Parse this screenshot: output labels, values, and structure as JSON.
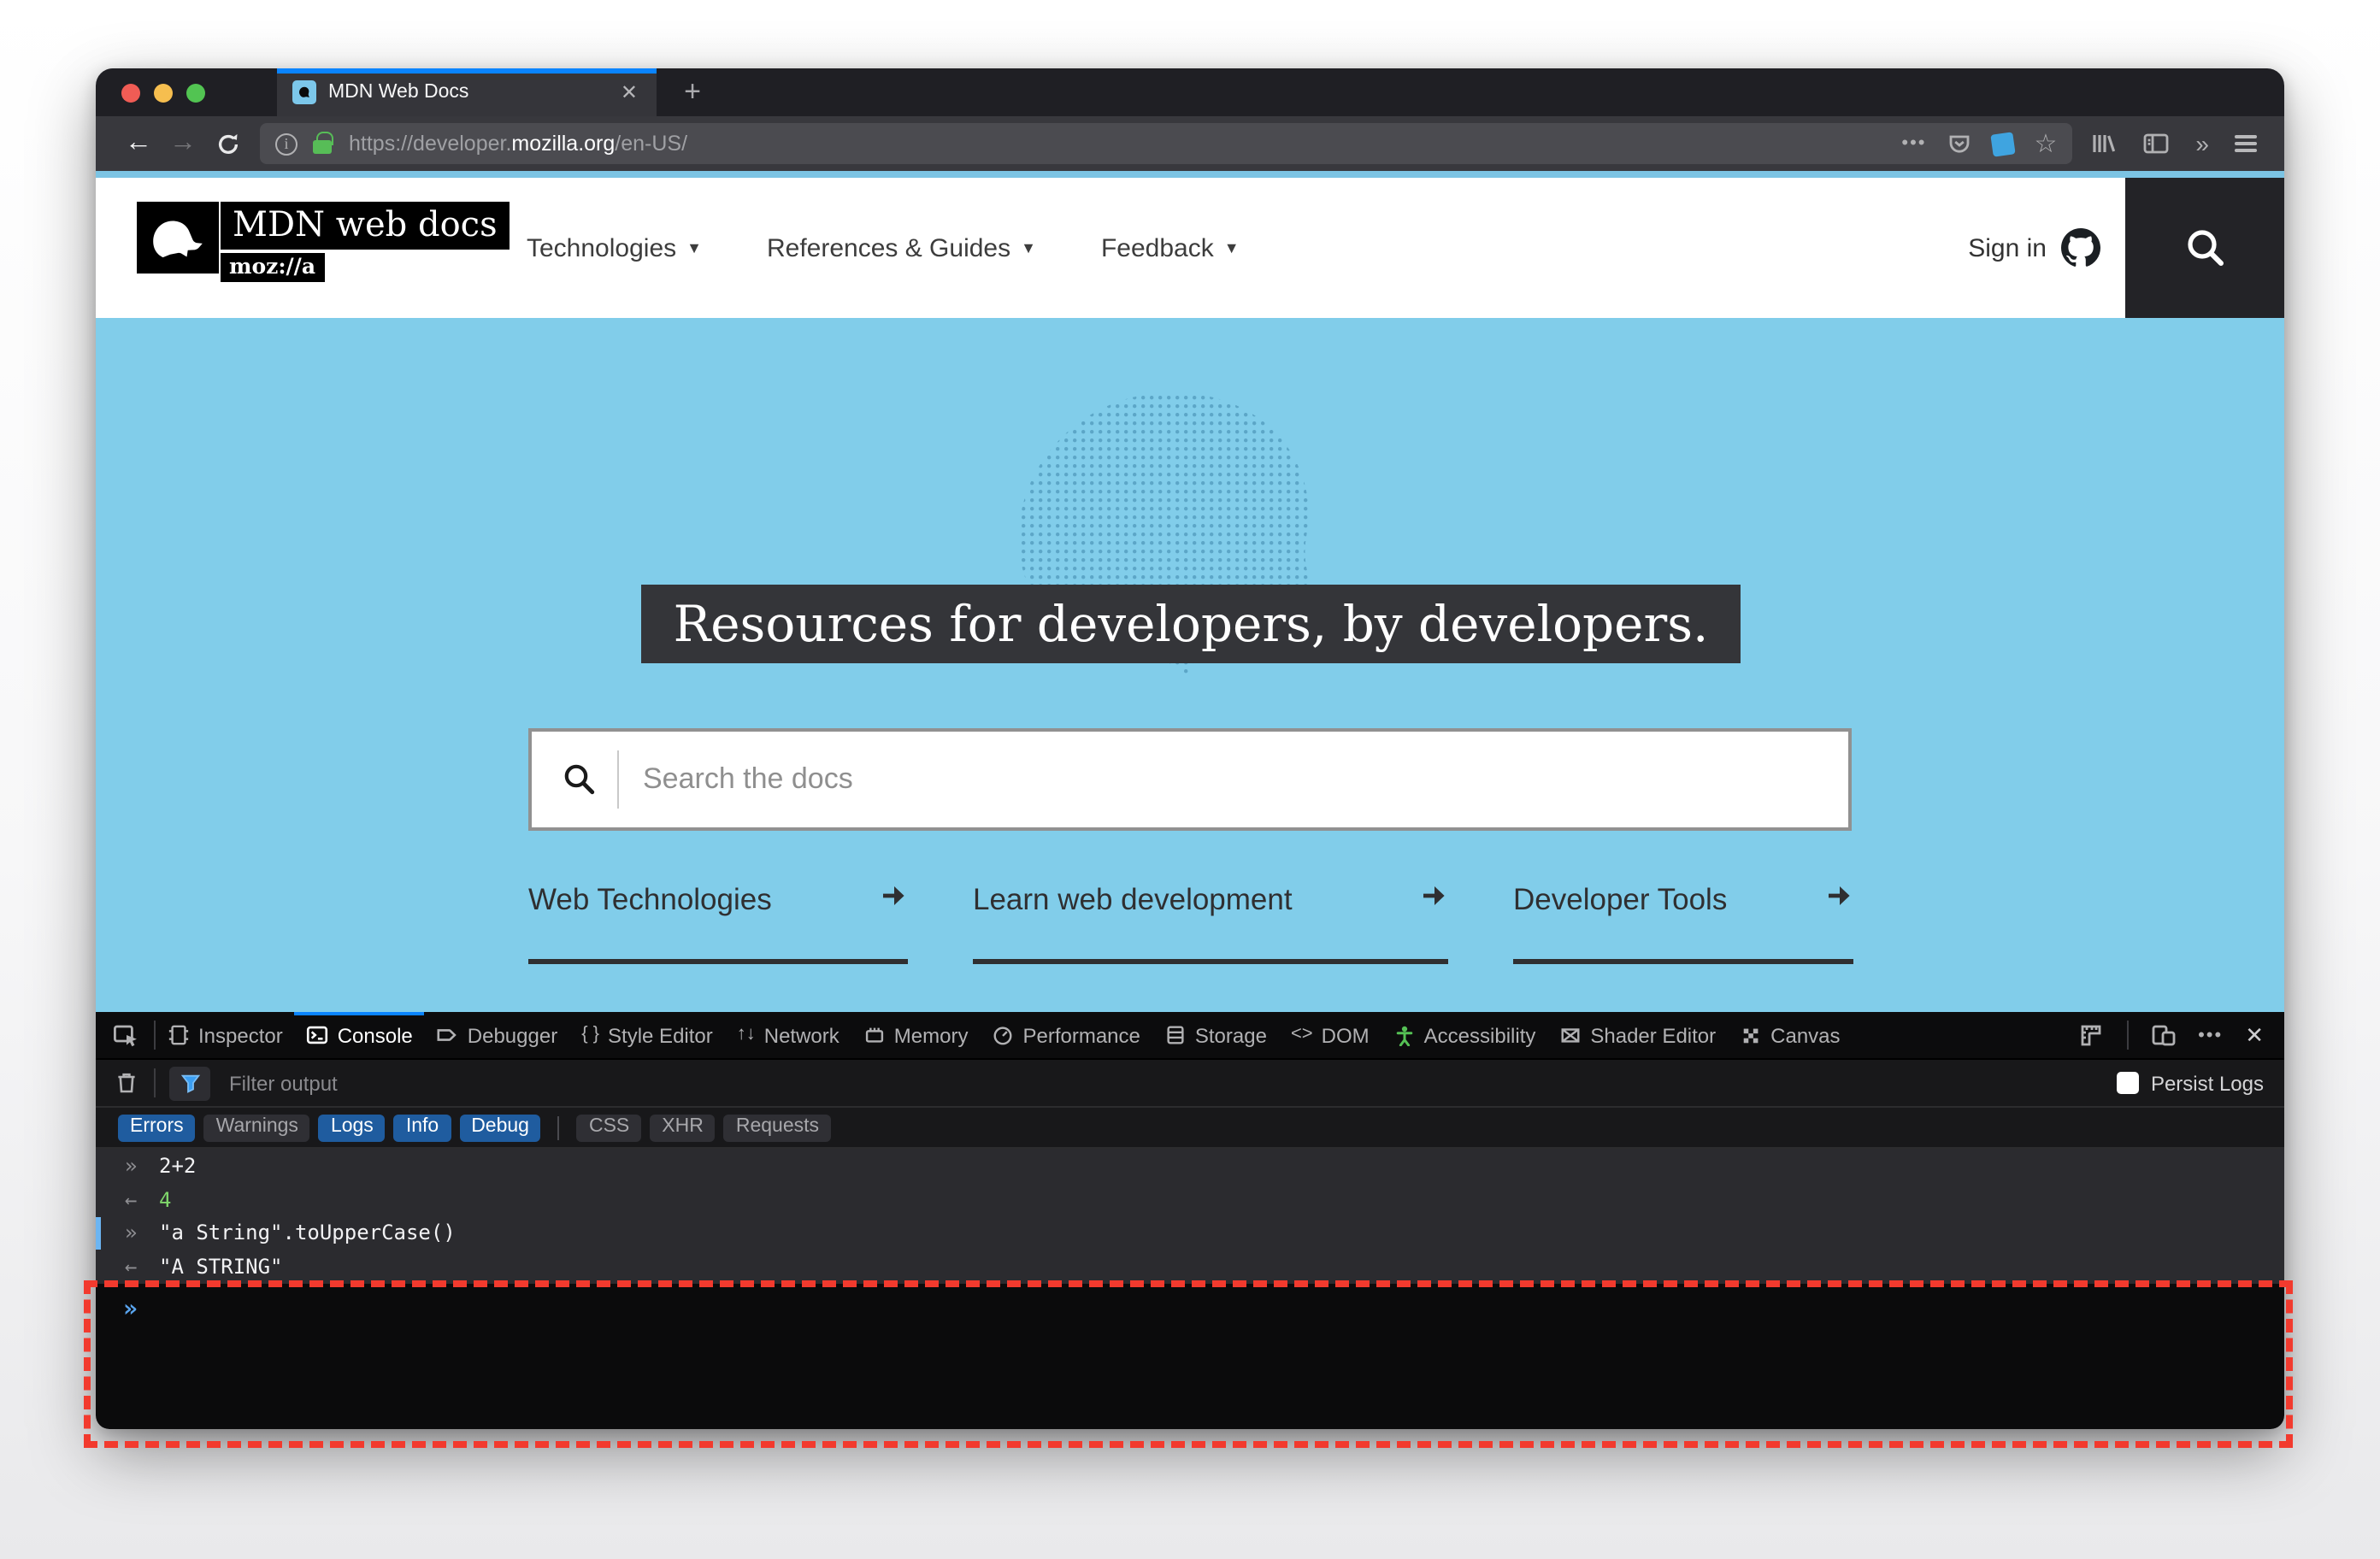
{
  "icons": {
    "close": "✕",
    "plus": "+",
    "back": "←",
    "forward": "→",
    "dots": "•••",
    "star": "☆",
    "double_chevron": "»",
    "caret": "▼",
    "braces": "{ }",
    "updown": "↑↓",
    "angle_brackets": "<>",
    "bullets": "•••"
  },
  "tab_bar": {
    "title": "MDN Web Docs"
  },
  "url_bar": {
    "prefix": "https://developer.",
    "domain": "mozilla.org",
    "path": "/en-US/"
  },
  "mdn_header": {
    "logo_title": "MDN web docs",
    "logo_tag": "moz://a",
    "nav": [
      {
        "label": "Technologies"
      },
      {
        "label": "References & Guides"
      },
      {
        "label": "Feedback"
      }
    ],
    "sign_in": "Sign in"
  },
  "hero": {
    "headline": "Resources for developers, by developers.",
    "search_placeholder": "Search the docs",
    "links": [
      {
        "label": "Web Technologies"
      },
      {
        "label": "Learn web development"
      },
      {
        "label": "Developer Tools"
      }
    ]
  },
  "devtools": {
    "tabs": [
      {
        "label": "Inspector",
        "active": false
      },
      {
        "label": "Console",
        "active": true
      },
      {
        "label": "Debugger",
        "active": false
      },
      {
        "label": "Style Editor",
        "active": false
      },
      {
        "label": "Network",
        "active": false
      },
      {
        "label": "Memory",
        "active": false
      },
      {
        "label": "Performance",
        "active": false
      },
      {
        "label": "Storage",
        "active": false
      },
      {
        "label": "DOM",
        "active": false
      },
      {
        "label": "Accessibility",
        "active": false
      },
      {
        "label": "Shader Editor",
        "active": false
      },
      {
        "label": "Canvas",
        "active": false
      }
    ],
    "filter_placeholder": "Filter output",
    "persist_label": "Persist Logs",
    "chips": [
      {
        "label": "Errors",
        "active": true
      },
      {
        "label": "Warnings",
        "active": false
      },
      {
        "label": "Logs",
        "active": true
      },
      {
        "label": "Info",
        "active": true
      },
      {
        "label": "Debug",
        "active": true
      },
      {
        "label": "CSS",
        "active": false
      },
      {
        "label": "XHR",
        "active": false
      },
      {
        "label": "Requests",
        "active": false
      }
    ],
    "lines": [
      {
        "prompt": "»",
        "text": "2+2"
      },
      {
        "arrow": "←",
        "text": "4"
      },
      {
        "prompt": "»",
        "text": "\"a String\".toUpperCase()"
      },
      {
        "arrow": "←",
        "text": "\"A STRING\""
      }
    ],
    "input_prompt": "»"
  },
  "colors": {
    "accent_blue": "#0a84ff",
    "hero_blue": "#81cdea",
    "chip_blue": "#1f5c9f",
    "result_green": "#7fd66b",
    "highlight_red": "#f23a2e",
    "prompt_blue": "#59a4ee"
  }
}
